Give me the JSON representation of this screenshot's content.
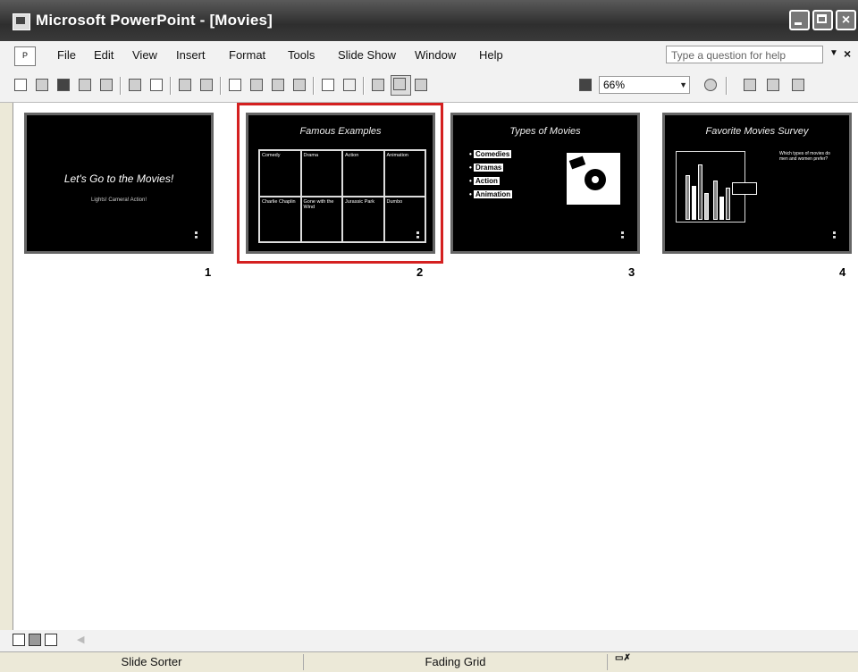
{
  "window": {
    "title": "Microsoft PowerPoint - [Movies]"
  },
  "menu": {
    "items": [
      "File",
      "Edit",
      "View",
      "Insert",
      "Format",
      "Tools",
      "Slide Show",
      "Window",
      "Help"
    ],
    "ask_placeholder": "Type a question for help"
  },
  "toolbar": {
    "zoom": "66%",
    "buttons": [
      "new-icon",
      "open-icon",
      "save-icon",
      "permission-icon",
      "email-icon",
      "print-icon",
      "print-preview-icon",
      "spelling-icon",
      "research-icon",
      "cut-icon",
      "copy-icon",
      "paste-icon",
      "format-painter-icon",
      "undo-icon",
      "redo-icon",
      "expand-icon",
      "grayscale-icon",
      "show-formatting-icon",
      "color-icon",
      "help-icon",
      "slide-design-icon",
      "new-slide-icon"
    ]
  },
  "slides": [
    {
      "number": "1",
      "title": "Let's Go to the Movies!",
      "subtitle": "Lights! Camera! Action!"
    },
    {
      "number": "2",
      "title": "Famous Examples",
      "table": [
        [
          "Comedy",
          "Drama",
          "Action",
          "Animation"
        ],
        [
          "Charlie Chaplin",
          "Gone with the Wind",
          "Jurassic Park",
          "Dumbo"
        ]
      ],
      "selected": true
    },
    {
      "number": "3",
      "title": "Types of Movies",
      "bullets": [
        "Comedies",
        "Dramas",
        "Action",
        "Animation"
      ]
    },
    {
      "number": "4",
      "title": "Favorite Movies Survey",
      "note": "Which types of movies do men and women prefer?"
    }
  ],
  "status": {
    "view": "Slide Sorter",
    "design": "Fading Grid"
  }
}
